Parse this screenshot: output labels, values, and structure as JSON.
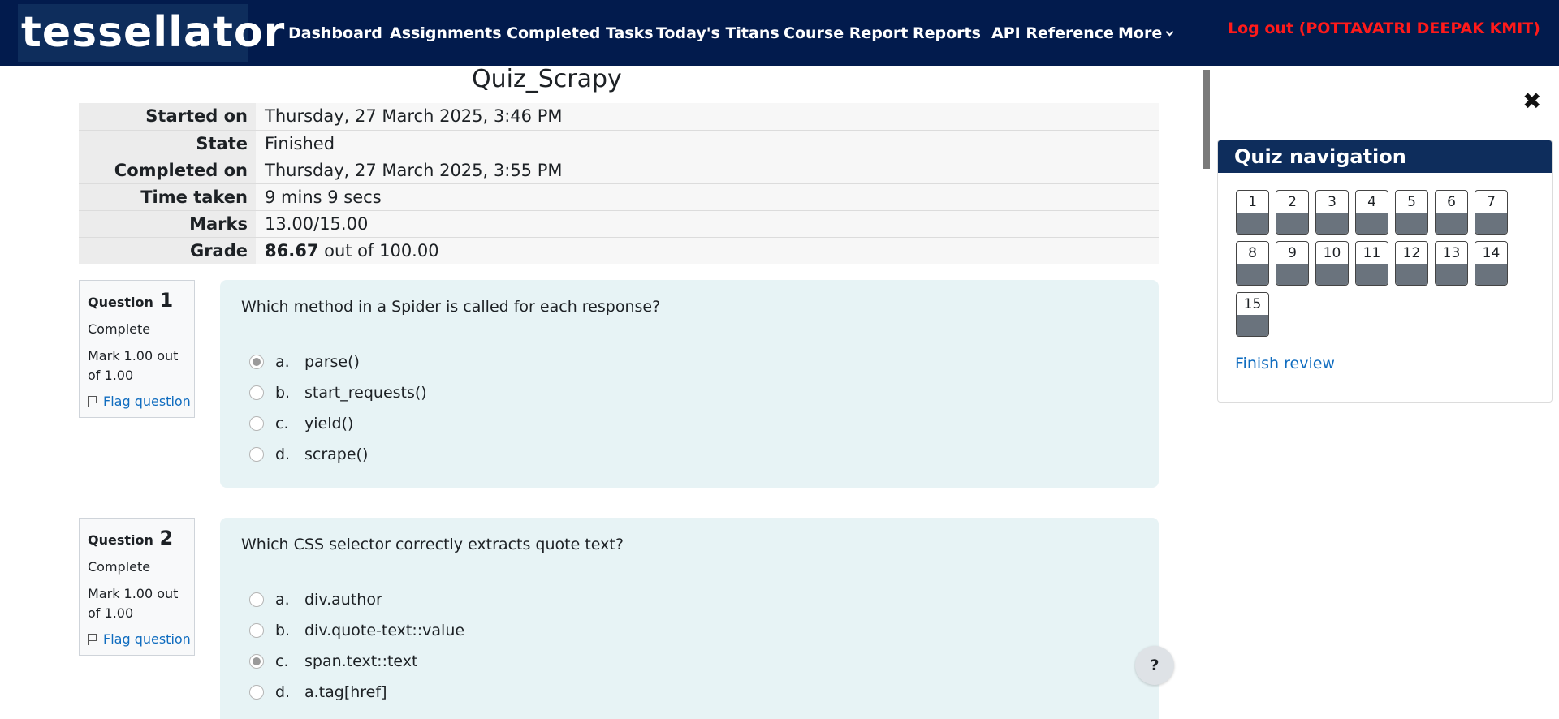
{
  "navbar": {
    "brand": "tessellator",
    "items": [
      "Dashboard",
      "Assignments",
      "Completed Tasks",
      "Today's Titans",
      "Course Report",
      "Reports",
      "API Reference",
      "More"
    ],
    "logout": "Log out (POTTAVATRI DEEPAK KMIT)"
  },
  "page": {
    "title": "Quiz_Scrapy"
  },
  "summary": {
    "rows": [
      {
        "label": "Started on",
        "value": "Thursday, 27 March 2025, 3:46 PM"
      },
      {
        "label": "State",
        "value": "Finished"
      },
      {
        "label": "Completed on",
        "value": "Thursday, 27 March 2025, 3:55 PM"
      },
      {
        "label": "Time taken",
        "value": "9 mins 9 secs"
      },
      {
        "label": "Marks",
        "value": "13.00/15.00"
      },
      {
        "label": "Grade",
        "value_bold": "86.67",
        "value_rest": " out of 100.00"
      }
    ]
  },
  "questions": [
    {
      "prefix": "Question",
      "number": "1",
      "state": "Complete",
      "mark": "Mark 1.00 out of 1.00",
      "flag": "Flag question",
      "text": "Which method in a Spider is called for each response?",
      "answers": [
        {
          "letter": "a.",
          "text": "parse()"
        },
        {
          "letter": "b.",
          "text": "start_requests()"
        },
        {
          "letter": "c.",
          "text": "yield()"
        },
        {
          "letter": "d.",
          "text": "scrape()"
        }
      ],
      "selected": 0
    },
    {
      "prefix": "Question",
      "number": "2",
      "state": "Complete",
      "mark": "Mark 1.00 out of 1.00",
      "flag": "Flag question",
      "text": "Which CSS selector correctly extracts quote text?",
      "answers": [
        {
          "letter": "a.",
          "text": "div.author"
        },
        {
          "letter": "b.",
          "text": "div.quote-text::value"
        },
        {
          "letter": "c.",
          "text": "span.text::text"
        },
        {
          "letter": "d.",
          "text": "a.tag[href]"
        }
      ],
      "selected": 2
    }
  ],
  "sidebar": {
    "close_icon": "close-icon",
    "title": "Quiz navigation",
    "buttons": [
      "1",
      "2",
      "3",
      "4",
      "5",
      "6",
      "7",
      "8",
      "9",
      "10",
      "11",
      "12",
      "13",
      "14",
      "15"
    ],
    "finish": "Finish review"
  },
  "help": {
    "label": "?"
  },
  "colors": {
    "navbar": "#021b4d",
    "logout": "#ff1a1a",
    "question_bg": "#e7f3f5",
    "link": "#0f6cbf",
    "nav_header": "#0e2d5c"
  }
}
